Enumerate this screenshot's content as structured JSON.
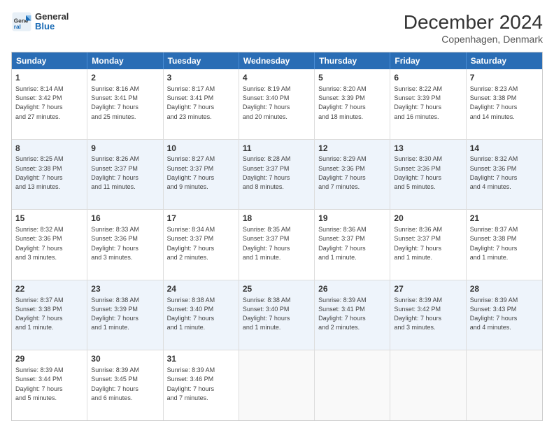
{
  "header": {
    "logo_general": "General",
    "logo_blue": "Blue",
    "title": "December 2024",
    "subtitle": "Copenhagen, Denmark"
  },
  "calendar": {
    "days": [
      "Sunday",
      "Monday",
      "Tuesday",
      "Wednesday",
      "Thursday",
      "Friday",
      "Saturday"
    ],
    "rows": [
      [
        {
          "day": "1",
          "info": "Sunrise: 8:14 AM\nSunset: 3:42 PM\nDaylight: 7 hours\nand 27 minutes.",
          "empty": false,
          "alt": false
        },
        {
          "day": "2",
          "info": "Sunrise: 8:16 AM\nSunset: 3:41 PM\nDaylight: 7 hours\nand 25 minutes.",
          "empty": false,
          "alt": false
        },
        {
          "day": "3",
          "info": "Sunrise: 8:17 AM\nSunset: 3:41 PM\nDaylight: 7 hours\nand 23 minutes.",
          "empty": false,
          "alt": false
        },
        {
          "day": "4",
          "info": "Sunrise: 8:19 AM\nSunset: 3:40 PM\nDaylight: 7 hours\nand 20 minutes.",
          "empty": false,
          "alt": false
        },
        {
          "day": "5",
          "info": "Sunrise: 8:20 AM\nSunset: 3:39 PM\nDaylight: 7 hours\nand 18 minutes.",
          "empty": false,
          "alt": false
        },
        {
          "day": "6",
          "info": "Sunrise: 8:22 AM\nSunset: 3:39 PM\nDaylight: 7 hours\nand 16 minutes.",
          "empty": false,
          "alt": false
        },
        {
          "day": "7",
          "info": "Sunrise: 8:23 AM\nSunset: 3:38 PM\nDaylight: 7 hours\nand 14 minutes.",
          "empty": false,
          "alt": false
        }
      ],
      [
        {
          "day": "8",
          "info": "Sunrise: 8:25 AM\nSunset: 3:38 PM\nDaylight: 7 hours\nand 13 minutes.",
          "empty": false,
          "alt": true
        },
        {
          "day": "9",
          "info": "Sunrise: 8:26 AM\nSunset: 3:37 PM\nDaylight: 7 hours\nand 11 minutes.",
          "empty": false,
          "alt": true
        },
        {
          "day": "10",
          "info": "Sunrise: 8:27 AM\nSunset: 3:37 PM\nDaylight: 7 hours\nand 9 minutes.",
          "empty": false,
          "alt": true
        },
        {
          "day": "11",
          "info": "Sunrise: 8:28 AM\nSunset: 3:37 PM\nDaylight: 7 hours\nand 8 minutes.",
          "empty": false,
          "alt": true
        },
        {
          "day": "12",
          "info": "Sunrise: 8:29 AM\nSunset: 3:36 PM\nDaylight: 7 hours\nand 7 minutes.",
          "empty": false,
          "alt": true
        },
        {
          "day": "13",
          "info": "Sunrise: 8:30 AM\nSunset: 3:36 PM\nDaylight: 7 hours\nand 5 minutes.",
          "empty": false,
          "alt": true
        },
        {
          "day": "14",
          "info": "Sunrise: 8:32 AM\nSunset: 3:36 PM\nDaylight: 7 hours\nand 4 minutes.",
          "empty": false,
          "alt": true
        }
      ],
      [
        {
          "day": "15",
          "info": "Sunrise: 8:32 AM\nSunset: 3:36 PM\nDaylight: 7 hours\nand 3 minutes.",
          "empty": false,
          "alt": false
        },
        {
          "day": "16",
          "info": "Sunrise: 8:33 AM\nSunset: 3:36 PM\nDaylight: 7 hours\nand 3 minutes.",
          "empty": false,
          "alt": false
        },
        {
          "day": "17",
          "info": "Sunrise: 8:34 AM\nSunset: 3:37 PM\nDaylight: 7 hours\nand 2 minutes.",
          "empty": false,
          "alt": false
        },
        {
          "day": "18",
          "info": "Sunrise: 8:35 AM\nSunset: 3:37 PM\nDaylight: 7 hours\nand 1 minute.",
          "empty": false,
          "alt": false
        },
        {
          "day": "19",
          "info": "Sunrise: 8:36 AM\nSunset: 3:37 PM\nDaylight: 7 hours\nand 1 minute.",
          "empty": false,
          "alt": false
        },
        {
          "day": "20",
          "info": "Sunrise: 8:36 AM\nSunset: 3:37 PM\nDaylight: 7 hours\nand 1 minute.",
          "empty": false,
          "alt": false
        },
        {
          "day": "21",
          "info": "Sunrise: 8:37 AM\nSunset: 3:38 PM\nDaylight: 7 hours\nand 1 minute.",
          "empty": false,
          "alt": false
        }
      ],
      [
        {
          "day": "22",
          "info": "Sunrise: 8:37 AM\nSunset: 3:38 PM\nDaylight: 7 hours\nand 1 minute.",
          "empty": false,
          "alt": true
        },
        {
          "day": "23",
          "info": "Sunrise: 8:38 AM\nSunset: 3:39 PM\nDaylight: 7 hours\nand 1 minute.",
          "empty": false,
          "alt": true
        },
        {
          "day": "24",
          "info": "Sunrise: 8:38 AM\nSunset: 3:40 PM\nDaylight: 7 hours\nand 1 minute.",
          "empty": false,
          "alt": true
        },
        {
          "day": "25",
          "info": "Sunrise: 8:38 AM\nSunset: 3:40 PM\nDaylight: 7 hours\nand 1 minute.",
          "empty": false,
          "alt": true
        },
        {
          "day": "26",
          "info": "Sunrise: 8:39 AM\nSunset: 3:41 PM\nDaylight: 7 hours\nand 2 minutes.",
          "empty": false,
          "alt": true
        },
        {
          "day": "27",
          "info": "Sunrise: 8:39 AM\nSunset: 3:42 PM\nDaylight: 7 hours\nand 3 minutes.",
          "empty": false,
          "alt": true
        },
        {
          "day": "28",
          "info": "Sunrise: 8:39 AM\nSunset: 3:43 PM\nDaylight: 7 hours\nand 4 minutes.",
          "empty": false,
          "alt": true
        }
      ],
      [
        {
          "day": "29",
          "info": "Sunrise: 8:39 AM\nSunset: 3:44 PM\nDaylight: 7 hours\nand 5 minutes.",
          "empty": false,
          "alt": false
        },
        {
          "day": "30",
          "info": "Sunrise: 8:39 AM\nSunset: 3:45 PM\nDaylight: 7 hours\nand 6 minutes.",
          "empty": false,
          "alt": false
        },
        {
          "day": "31",
          "info": "Sunrise: 8:39 AM\nSunset: 3:46 PM\nDaylight: 7 hours\nand 7 minutes.",
          "empty": false,
          "alt": false
        },
        {
          "day": "",
          "info": "",
          "empty": true,
          "alt": false
        },
        {
          "day": "",
          "info": "",
          "empty": true,
          "alt": false
        },
        {
          "day": "",
          "info": "",
          "empty": true,
          "alt": false
        },
        {
          "day": "",
          "info": "",
          "empty": true,
          "alt": false
        }
      ]
    ]
  }
}
